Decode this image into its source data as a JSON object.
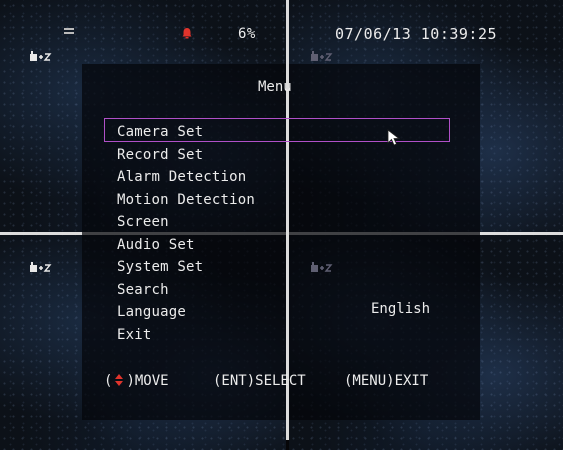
{
  "status_bar": {
    "record_icon": "record-indicator-icon",
    "alarm_icon": "alarm-bell-icon",
    "percent": "6%",
    "datetime": "07/06/13 10:39:25",
    "alarm_color": "#e0342c"
  },
  "camera_icons": [
    "camera-status-icon",
    "camera-status-icon",
    "camera-status-icon",
    "camera-status-icon"
  ],
  "menu": {
    "title": "Menu",
    "items": [
      {
        "label": "Camera Set"
      },
      {
        "label": "Record Set"
      },
      {
        "label": "Alarm Detection"
      },
      {
        "label": "Motion Detection"
      },
      {
        "label": "Screen"
      },
      {
        "label": "Audio Set"
      },
      {
        "label": "System Set"
      },
      {
        "label": "Search"
      },
      {
        "label": "Language",
        "value": "English"
      },
      {
        "label": "Exit"
      }
    ],
    "selected_index": 0,
    "selection_color": "#b050c8"
  },
  "footer": {
    "move_prefix": "(",
    "move_suffix": ")MOVE",
    "arrows_icon": "up-down-arrows-icon",
    "select": "(ENT)SELECT",
    "exit": "(MENU)EXIT",
    "arrow_color": "#e0342c"
  }
}
